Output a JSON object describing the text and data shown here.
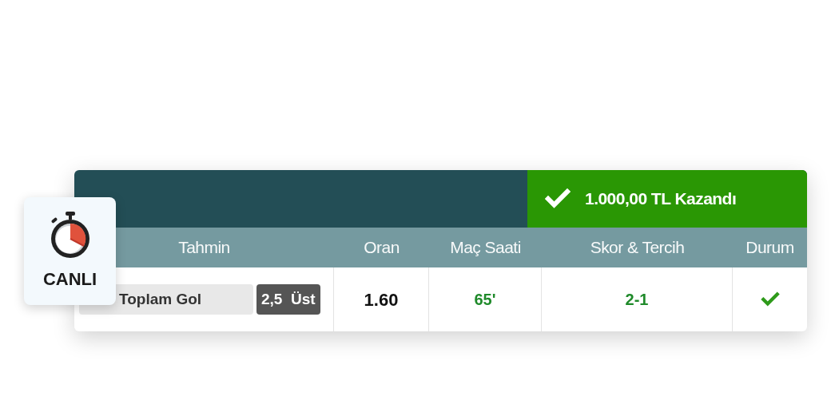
{
  "badge": {
    "label": "CANLI"
  },
  "result": {
    "won": true,
    "text": "1.000,00 TL Kazandı"
  },
  "columns": [
    "Tahmin",
    "Oran",
    "Maç Saati",
    "Skor & Tercih",
    "Durum"
  ],
  "row": {
    "market": "Toplam Gol",
    "pick": "2,5  Üst",
    "odds": "1.60",
    "minute": "65'",
    "score": "2-1",
    "won": true
  }
}
